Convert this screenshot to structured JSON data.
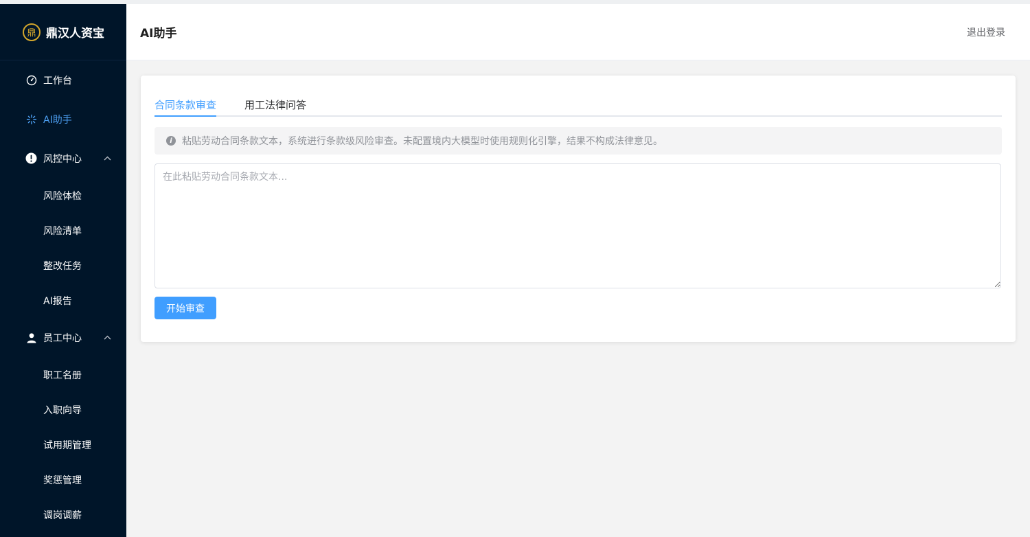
{
  "brand": {
    "name": "鼎汉人资宝",
    "logo_char": "鼎"
  },
  "sidebar": {
    "items": [
      {
        "label": "工作台",
        "icon": "dashboard-gauge-icon"
      },
      {
        "label": "AI助手",
        "icon": "sparkle-icon",
        "active": true
      },
      {
        "label": "风控中心",
        "icon": "alert-circle-icon",
        "expanded": true,
        "children": [
          "风险体检",
          "风险清单",
          "整改任务",
          "AI报告"
        ]
      },
      {
        "label": "员工中心",
        "icon": "user-icon",
        "expanded": true,
        "children": [
          "职工名册",
          "入职向导",
          "试用期管理",
          "奖惩管理",
          "调岗调薪"
        ]
      }
    ]
  },
  "header": {
    "title": "AI助手",
    "logout_label": "退出登录"
  },
  "main": {
    "tabs": [
      {
        "label": "合同条款审查",
        "active": true
      },
      {
        "label": "用工法律问答",
        "active": false
      }
    ],
    "notice": "粘贴劳动合同条款文本，系统进行条款级风险审查。未配置境内大模型时使用规则化引擎，结果不构成法律意见。",
    "textarea_placeholder": "在此粘贴劳动合同条款文本...",
    "submit_label": "开始审查"
  },
  "colors": {
    "sidebar_bg": "#001529",
    "accent": "#409eff",
    "brand_gold": "#d4a72c"
  }
}
